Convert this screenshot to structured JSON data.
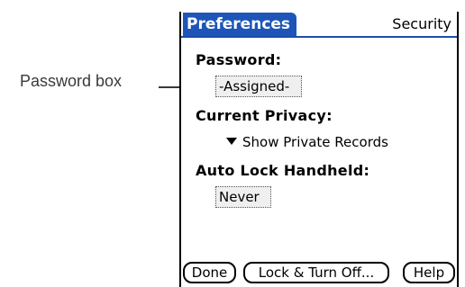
{
  "callout": {
    "text": "Password box"
  },
  "header": {
    "title": "Preferences",
    "section": "Security"
  },
  "password": {
    "label": "Password:",
    "value": "-Assigned-"
  },
  "privacy": {
    "label": "Current Privacy:",
    "value": "Show Private Records"
  },
  "autolock": {
    "label": "Auto Lock Handheld:",
    "value": "Never"
  },
  "buttons": {
    "done": "Done",
    "lock": "Lock & Turn Off...",
    "help": "Help"
  },
  "colors": {
    "title_bar": "#1d56b8",
    "box_bg": "#efefef"
  }
}
